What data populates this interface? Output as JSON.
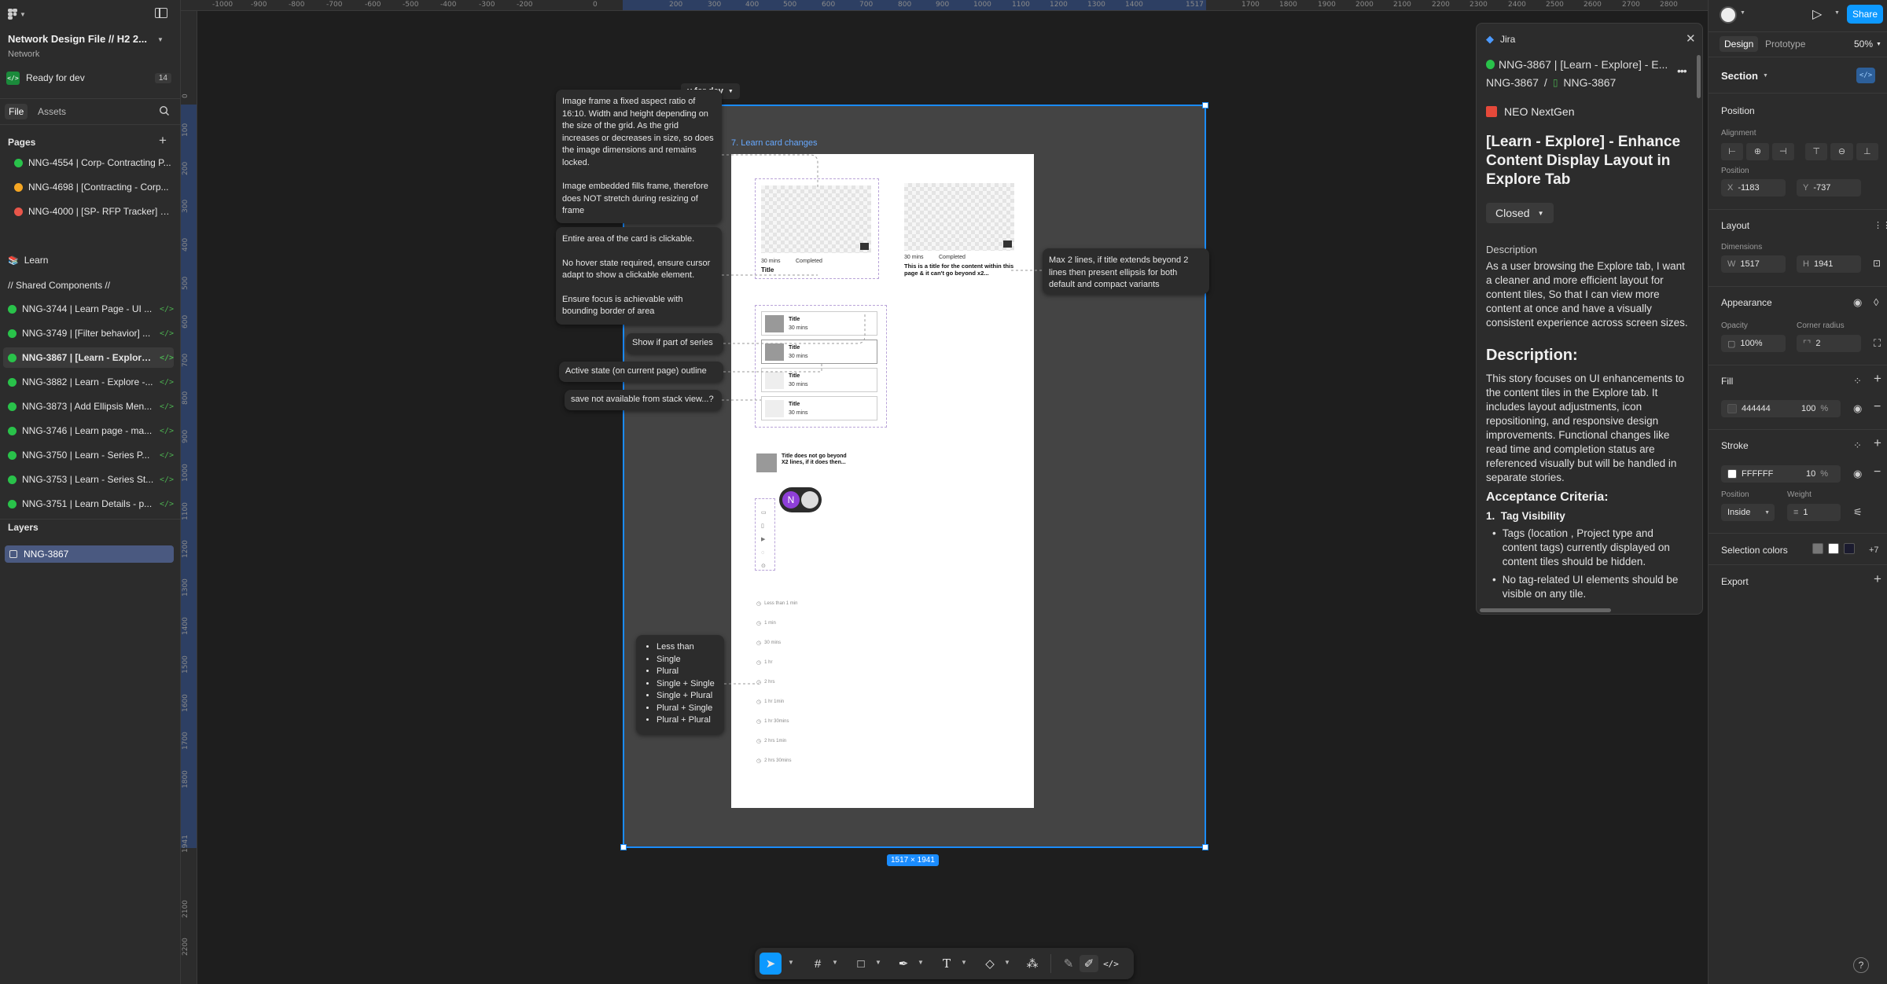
{
  "file": {
    "title": "Network Design File // H2 2...",
    "team": "Network",
    "dev_status": "Ready for dev",
    "dev_count": "14"
  },
  "left_tabs": {
    "file": "File",
    "assets": "Assets"
  },
  "pages_heading": "Pages",
  "pages": [
    {
      "label": "NNG-4554 | Corp- Contracting P...",
      "status_color": "#29c24a"
    },
    {
      "label": "NNG-4698 | [Contracting - Corp...",
      "status_color": "#f5a623"
    },
    {
      "label": "NNG-4000 | [SP- RFP Tracker] U...",
      "status_color": "#e8564a"
    }
  ],
  "learn_label": "Learn",
  "shared_label": "// Shared Components //",
  "dev_pages": [
    {
      "label": "NNG-3744 | Learn Page - UI ..."
    },
    {
      "label": "NNG-3749 | [Filter behavior] ..."
    },
    {
      "label": "NNG-3867 | [Learn - Explore..."
    },
    {
      "label": "NNG-3882 | Learn - Explore -..."
    },
    {
      "label": "NNG-3873 | Add Ellipsis Men..."
    },
    {
      "label": "NNG-3746 | Learn page - ma..."
    },
    {
      "label": "NNG-3750 | Learn - Series P..."
    },
    {
      "label": "NNG-3753 | Learn - Series St..."
    },
    {
      "label": "NNG-3751 | Learn Details - p..."
    }
  ],
  "layers_heading": "Layers",
  "layer_item": "NNG-3867",
  "dev_icon": "</>",
  "ruler_top": [
    "-1000",
    "-900",
    "-800",
    "-700",
    "-600",
    "-500",
    "-400",
    "-300",
    "-200",
    "0",
    "200",
    "300",
    "400",
    "500",
    "600",
    "700",
    "800",
    "900",
    "1000",
    "1100",
    "1200",
    "1300",
    "1400",
    "1517",
    "1700",
    "1800",
    "1900",
    "2000",
    "2100",
    "2200",
    "2300",
    "2400",
    "2500",
    "2600",
    "2700",
    "2800"
  ],
  "ruler_left": [
    "0",
    "100",
    "200",
    "300",
    "400",
    "500",
    "600",
    "700",
    "800",
    "900",
    "1000",
    "1100",
    "1200",
    "1300",
    "1400",
    "1500",
    "1600",
    "1700",
    "1800",
    "1941",
    "2100",
    "2200"
  ],
  "canvas": {
    "section_tag": "y for dev",
    "frame_label": "7. Learn card changes",
    "size_badge": "1517 × 1941",
    "section_fill": "#444444",
    "selection_color": "#1a8cff"
  },
  "notes": {
    "image_frame": "Image frame a fixed aspect ratio of 16:10. Width and height depending on the size of the grid. As the grid increases or decreases in size, so does the image dimensions and remains locked.",
    "image_fills": "Image embedded fills frame, therefore does NOT stretch during resizing of frame",
    "clickable_1": "Entire area of the card is clickable.",
    "clickable_2": "No hover state required, ensure cursor adapt to show a clickable element.",
    "clickable_3": "Ensure focus is achievable with bounding border of area",
    "series": "Show if part of series",
    "active": "Active state (on current page) outline",
    "save": "save not available from stack view...?",
    "max_lines": "Max 2 lines, if title extends beyond 2 lines then present ellipsis for both default and compact variants",
    "plural_list": [
      "Less than",
      "Single",
      "Plural",
      "Single + Single",
      "Single + Plural",
      "Plural + Single",
      "Plural + Plural"
    ]
  },
  "cards": {
    "title": "Title",
    "duration": "30 mins",
    "completed": "Completed",
    "long_title": "This is a title for the content within this page & it can't go beyond x2...",
    "compact_long": "Title does not go beyond X2 lines, if it does then...",
    "durations": [
      "Less than 1 min",
      "1 min",
      "30 mins",
      "1 hr",
      "2 hrs",
      "1 hr 1min",
      "1 hr 30mins",
      "2 hrs 1min",
      "2 hrs 30mins"
    ]
  },
  "avatar_initial": "N",
  "jira": {
    "header": "Jira",
    "issue_line": "NNG-3867 | [Learn - Explore] - E...",
    "crumb_parent": "NNG-3867",
    "crumb_child": "NNG-3867",
    "project": "NEO NextGen",
    "title": "[Learn - Explore] - Enhance Content Display Layout in Explore Tab",
    "status": "Closed",
    "desc_label": "Description",
    "story": "As a user browsing the Explore tab, I want a cleaner and more efficient layout for content tiles, So that I can view more content at once and have a visually consistent experience across screen sizes.",
    "desc_heading": "Description:",
    "desc_body": "This story focuses on UI enhancements to the content tiles in the Explore tab. It includes layout adjustments, icon repositioning, and responsive design improvements. Functional changes like read time and completion status are referenced visually but will be handled in separate stories.",
    "ac_heading": "Acceptance Criteria:",
    "ac_item": "Tag Visibility",
    "bullet1": "Tags (location , Project type and content tags) currently displayed on content tiles should be hidden.",
    "bullet2": "No tag-related UI elements should be visible on any tile."
  },
  "right": {
    "share": "Share",
    "tab_design": "Design",
    "tab_prototype": "Prototype",
    "zoom": "50%",
    "section_label": "Section",
    "position": "Position",
    "alignment": "Alignment",
    "position_sub": "Position",
    "x_label": "X",
    "x": "-1183",
    "y_label": "Y",
    "y": "-737",
    "layout": "Layout",
    "dimensions": "Dimensions",
    "w_label": "W",
    "w": "1517",
    "h_label": "H",
    "h": "1941",
    "appearance": "Appearance",
    "opacity_label": "Opacity",
    "opacity": "100%",
    "radius_label": "Corner radius",
    "radius": "2",
    "fill": "Fill",
    "fill_hex": "444444",
    "fill_opacity": "100",
    "pct": "%",
    "fill_color": "#444444",
    "stroke": "Stroke",
    "stroke_hex": "FFFFFF",
    "stroke_opacity": "10",
    "stroke_color": "#ffffff",
    "stroke_pos_label": "Position",
    "stroke_pos": "Inside",
    "weight_label": "Weight",
    "weight": "1",
    "selection_colors": "Selection colors",
    "sel_more": "+7",
    "sel_colors": [
      "#777777",
      "#ffffff",
      "#1b1b2f"
    ],
    "export": "Export"
  }
}
